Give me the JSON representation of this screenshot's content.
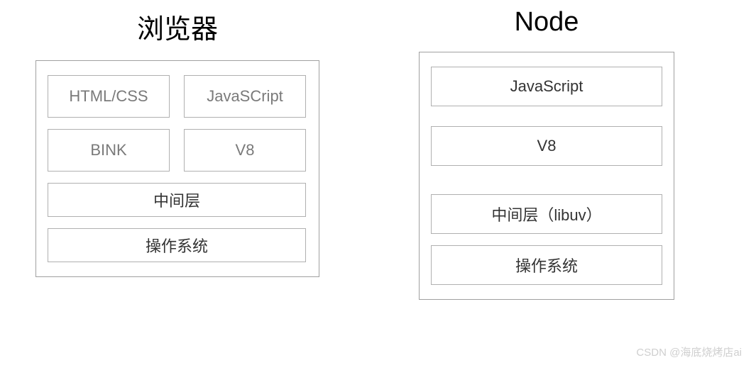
{
  "browser": {
    "title": "浏览器",
    "row1": {
      "left": "HTML/CSS",
      "right": "JavaSCript"
    },
    "row2": {
      "left": "BINK",
      "right": "V8"
    },
    "middle": "中间层",
    "os": "操作系统"
  },
  "node": {
    "title": "Node",
    "js": "JavaScript",
    "v8": "V8",
    "middle": "中间层（libuv）",
    "os": "操作系统"
  },
  "watermark": "CSDN @海底烧烤店ai"
}
